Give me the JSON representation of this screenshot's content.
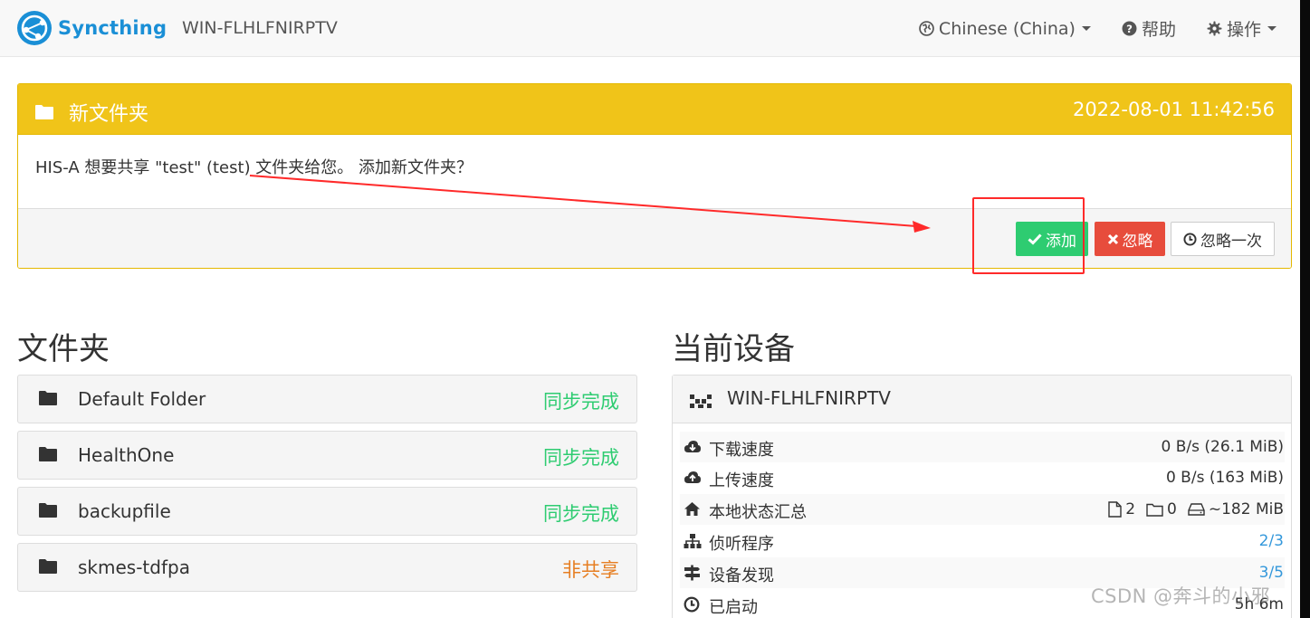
{
  "navbar": {
    "brand": "Syncthing",
    "device_name": "WIN-FLHLFNIRPTV",
    "language": "Chinese (China)",
    "help": "帮助",
    "actions": "操作"
  },
  "notice": {
    "title": "新文件夹",
    "timestamp": "2022-08-01 11:42:56",
    "message": "HIS-A 想要共享 \"test\" (test) 文件夹给您。 添加新文件夹？",
    "add_label": "添加",
    "ignore_label": "忽略",
    "ignore_once_label": "忽略一次"
  },
  "folders": {
    "heading": "文件夹",
    "items": [
      {
        "name": "Default Folder",
        "status": "同步完成"
      },
      {
        "name": "HealthOne",
        "status": "同步完成"
      },
      {
        "name": "backupfile",
        "status": "同步完成"
      },
      {
        "name": "skmes-tdfpa",
        "status": "非共享"
      }
    ]
  },
  "this_device": {
    "heading": "当前设备",
    "name": "WIN-FLHLFNIRPTV",
    "rows": {
      "download_label": "下载速度",
      "download_value": "0 B/s (26.1 MiB)",
      "upload_label": "上传速度",
      "upload_value": "0 B/s (163 MiB)",
      "local_state_label": "本地状态汇总",
      "files_count": "2",
      "dirs_count": "0",
      "size": "~182 MiB",
      "listeners_label": "侦听程序",
      "listeners_value": "2/3",
      "discovery_label": "设备发现",
      "discovery_value": "3/5",
      "uptime_label": "已启动",
      "uptime_value": "5h 6m"
    }
  },
  "watermark": "CSDN @奔斗的小邪",
  "colors": {
    "brand": "#1a8fd6",
    "notice_header": "#f0c419",
    "success": "#2ecc71",
    "danger": "#e74c3c",
    "warning": "#e67e22",
    "link": "#3498db",
    "annotation": "#ff2a2a"
  }
}
